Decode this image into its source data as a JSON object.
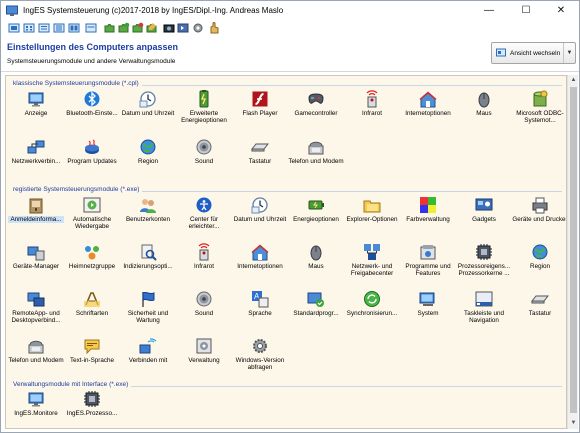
{
  "window": {
    "title": "IngES Systemsteuerung (c)2017-2018 by IngES/Dipl.-Ing. Andreas Maslo",
    "minimize": "—",
    "maximize": "☐",
    "close": "✕"
  },
  "header": {
    "title": "Einstellungen des Computers anpassen",
    "subtitle": "Systemsteuerungsmodule und andere Verwaltungsmodule",
    "view_button": "Ansicht wechseln",
    "view_arrow": "▼"
  },
  "scrollbar": {
    "up": "▲",
    "down": "▼"
  },
  "sections": [
    {
      "label": "klassische Systemsteuerungsmodule (*.cpl)",
      "items": [
        {
          "label": "Anzeige",
          "icon": "monitor-icon"
        },
        {
          "label": "Bluetooth-Einste...",
          "icon": "bluetooth-icon"
        },
        {
          "label": "Datum und Uhrzeit",
          "icon": "clock-icon"
        },
        {
          "label": "Erweiterte Energieoptionen",
          "icon": "power-icon"
        },
        {
          "label": "Flash Player",
          "icon": "flash-icon"
        },
        {
          "label": "Gamecontroller",
          "icon": "gamepad-icon"
        },
        {
          "label": "Infrarot",
          "icon": "infrared-icon"
        },
        {
          "label": "Internetoptionen",
          "icon": "internet-icon"
        },
        {
          "label": "Maus",
          "icon": "mouse-icon"
        },
        {
          "label": "Microsoft ODBC-Systemot...",
          "icon": "database-icon"
        },
        {
          "label": "Netzwerkverbin...",
          "icon": "network-icon"
        },
        {
          "label": "Program Updates",
          "icon": "java-icon"
        },
        {
          "label": "Region",
          "icon": "globe-icon"
        },
        {
          "label": "Sound",
          "icon": "speaker-icon"
        },
        {
          "label": "Tastatur",
          "icon": "keyboard-icon"
        },
        {
          "label": "Telefon und Modem",
          "icon": "phone-icon"
        }
      ]
    },
    {
      "label": "registierte Systemsteuerungsmodule (*.exe)",
      "items": [
        {
          "label": "Anmeldeinforma...",
          "icon": "credentials-icon"
        },
        {
          "label": "Automatische Wiedergabe",
          "icon": "autoplay-icon"
        },
        {
          "label": "Benutzerkonten",
          "icon": "users-icon"
        },
        {
          "label": "Center für erleichter...",
          "icon": "accessibility-icon"
        },
        {
          "label": "Datum und Uhrzeit",
          "icon": "clock-icon"
        },
        {
          "label": "Energieoptionen",
          "icon": "battery-icon"
        },
        {
          "label": "Explorer-Optionen",
          "icon": "folder-icon"
        },
        {
          "label": "Farbverwaltung",
          "icon": "color-icon"
        },
        {
          "label": "Gadgets",
          "icon": "gadgets-icon"
        },
        {
          "label": "Geräte und Drucker",
          "icon": "printer-icon"
        },
        {
          "label": "Geräte-Manager",
          "icon": "device-manager-icon"
        },
        {
          "label": "Heimnetzgruppe",
          "icon": "homegroup-icon"
        },
        {
          "label": "Indizierungsopti...",
          "icon": "indexing-icon"
        },
        {
          "label": "Infrarot",
          "icon": "infrared-icon"
        },
        {
          "label": "Internetoptionen",
          "icon": "internet-icon"
        },
        {
          "label": "Maus",
          "icon": "mouse-icon"
        },
        {
          "label": "Netzwerk- und Freigabecenter",
          "icon": "network-center-icon"
        },
        {
          "label": "Programme und Features",
          "icon": "programs-icon"
        },
        {
          "label": "Prozessoreigens... Prozessorkerne ...",
          "icon": "processor-icon"
        },
        {
          "label": "Region",
          "icon": "globe-icon"
        },
        {
          "label": "RemoteApp- und Desktopverbind...",
          "icon": "remote-icon"
        },
        {
          "label": "Schriftarten",
          "icon": "fonts-icon"
        },
        {
          "label": "Sicherheit und Wartung",
          "icon": "flag-icon"
        },
        {
          "label": "Sound",
          "icon": "speaker-icon"
        },
        {
          "label": "Sprache",
          "icon": "language-icon"
        },
        {
          "label": "Standardprogr...",
          "icon": "default-programs-icon"
        },
        {
          "label": "Synchronisierun...",
          "icon": "sync-icon"
        },
        {
          "label": "System",
          "icon": "system-icon"
        },
        {
          "label": "Taskleiste und Navigation",
          "icon": "taskbar-icon"
        },
        {
          "label": "Tastatur",
          "icon": "keyboard-icon"
        },
        {
          "label": "Telefon und Modem",
          "icon": "phone-icon"
        },
        {
          "label": "Text-in-Sprache",
          "icon": "speech-icon"
        },
        {
          "label": "Verbinden mit",
          "icon": "connect-icon"
        },
        {
          "label": "Verwaltung",
          "icon": "admin-tools-icon"
        },
        {
          "label": "Windows-Version abfragen",
          "icon": "gear-icon"
        }
      ]
    },
    {
      "label": "Verwaltungsmodule mit Interface (*.exe)",
      "items": [
        {
          "label": "IngES.Monitore",
          "icon": "monitor-icon"
        },
        {
          "label": "IngES.Prozesso...",
          "icon": "processor-icon"
        }
      ]
    }
  ],
  "colors": {
    "section_header": "#1d3b9c",
    "title": "#1c3ca3",
    "content_bg": "#fdf7ea",
    "selection": "#cde3f7"
  }
}
